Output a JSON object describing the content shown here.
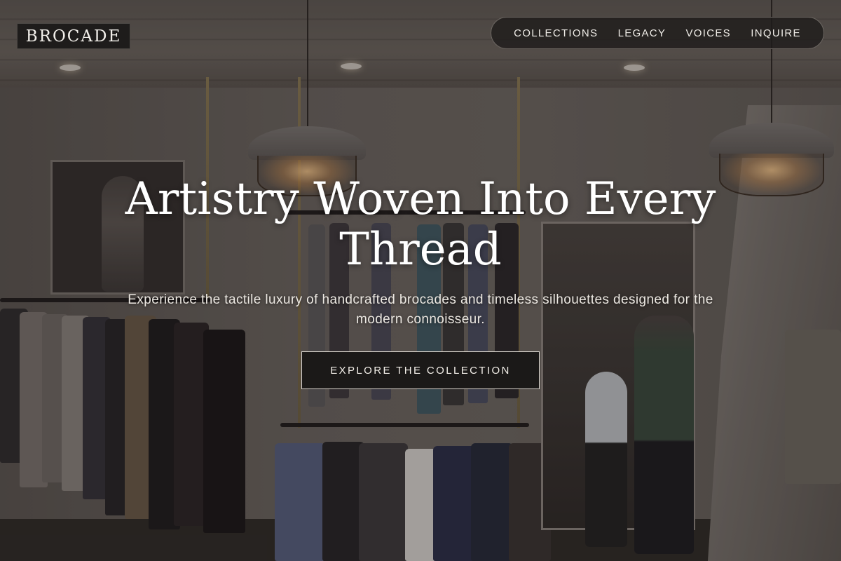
{
  "brand": {
    "logo_text": "BROCADE"
  },
  "nav": {
    "items": [
      {
        "label": "COLLECTIONS"
      },
      {
        "label": "LEGACY"
      },
      {
        "label": "VOICES"
      },
      {
        "label": "INQUIRE"
      }
    ]
  },
  "hero": {
    "title": "Artistry Woven Into Every Thread",
    "subtitle": "Experience the tactile luxury of handcrafted brocades and timeless silhouettes designed for the modern connoisseur.",
    "cta_label": "EXPLORE THE COLLECTION"
  },
  "colors": {
    "overlay": "#1e1c1b",
    "text": "#ffffff",
    "accent_border": "#d9d4cd"
  }
}
